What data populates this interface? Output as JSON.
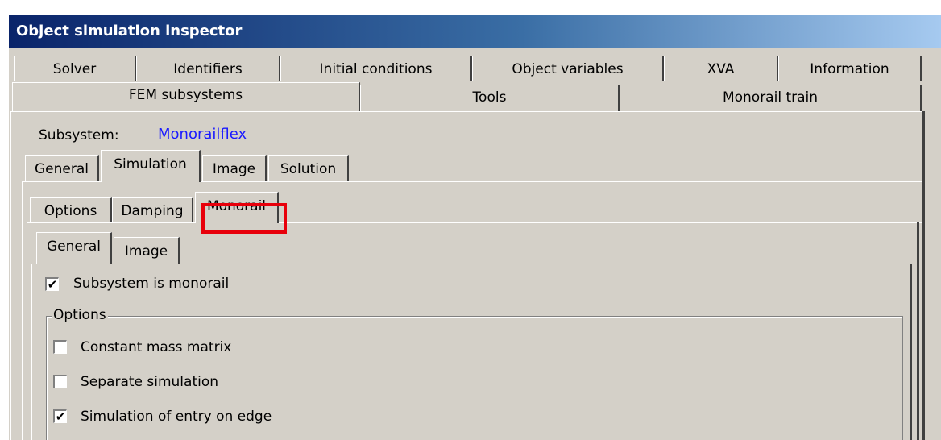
{
  "window": {
    "title": "Object simulation inspector"
  },
  "tabs_row1": [
    {
      "label": "Solver"
    },
    {
      "label": "Identifiers"
    },
    {
      "label": "Initial conditions"
    },
    {
      "label": "Object variables"
    },
    {
      "label": "XVA"
    },
    {
      "label": "Information"
    }
  ],
  "tabs_row2": [
    {
      "label": "FEM subsystems",
      "selected": true
    },
    {
      "label": "Tools"
    },
    {
      "label": "Monorail train"
    }
  ],
  "subsystem": {
    "label": "Subsystem:",
    "value": "Monorailflex",
    "value_color": "#1a1aff"
  },
  "subsystem_tabs": [
    {
      "label": "General"
    },
    {
      "label": "Simulation",
      "selected": true
    },
    {
      "label": "Image"
    },
    {
      "label": "Solution"
    }
  ],
  "simulation_tabs": [
    {
      "label": "Options"
    },
    {
      "label": "Damping"
    },
    {
      "label": "Monorail",
      "selected": true,
      "highlighted": true
    }
  ],
  "monorail_tabs": [
    {
      "label": "General",
      "selected": true
    },
    {
      "label": "Image"
    }
  ],
  "monorail_general": {
    "subsystem_is_monorail": {
      "label": "Subsystem is monorail",
      "checked": true
    },
    "options_group": {
      "title": "Options",
      "items": [
        {
          "label": "Constant mass matrix",
          "checked": false
        },
        {
          "label": "Separate simulation",
          "checked": false
        },
        {
          "label": "Simulation of entry on edge",
          "checked": true
        }
      ]
    }
  },
  "colors": {
    "highlight": "#e8000b",
    "title_gradient_start": "#0a246a",
    "title_gradient_end": "#a6caf0"
  }
}
